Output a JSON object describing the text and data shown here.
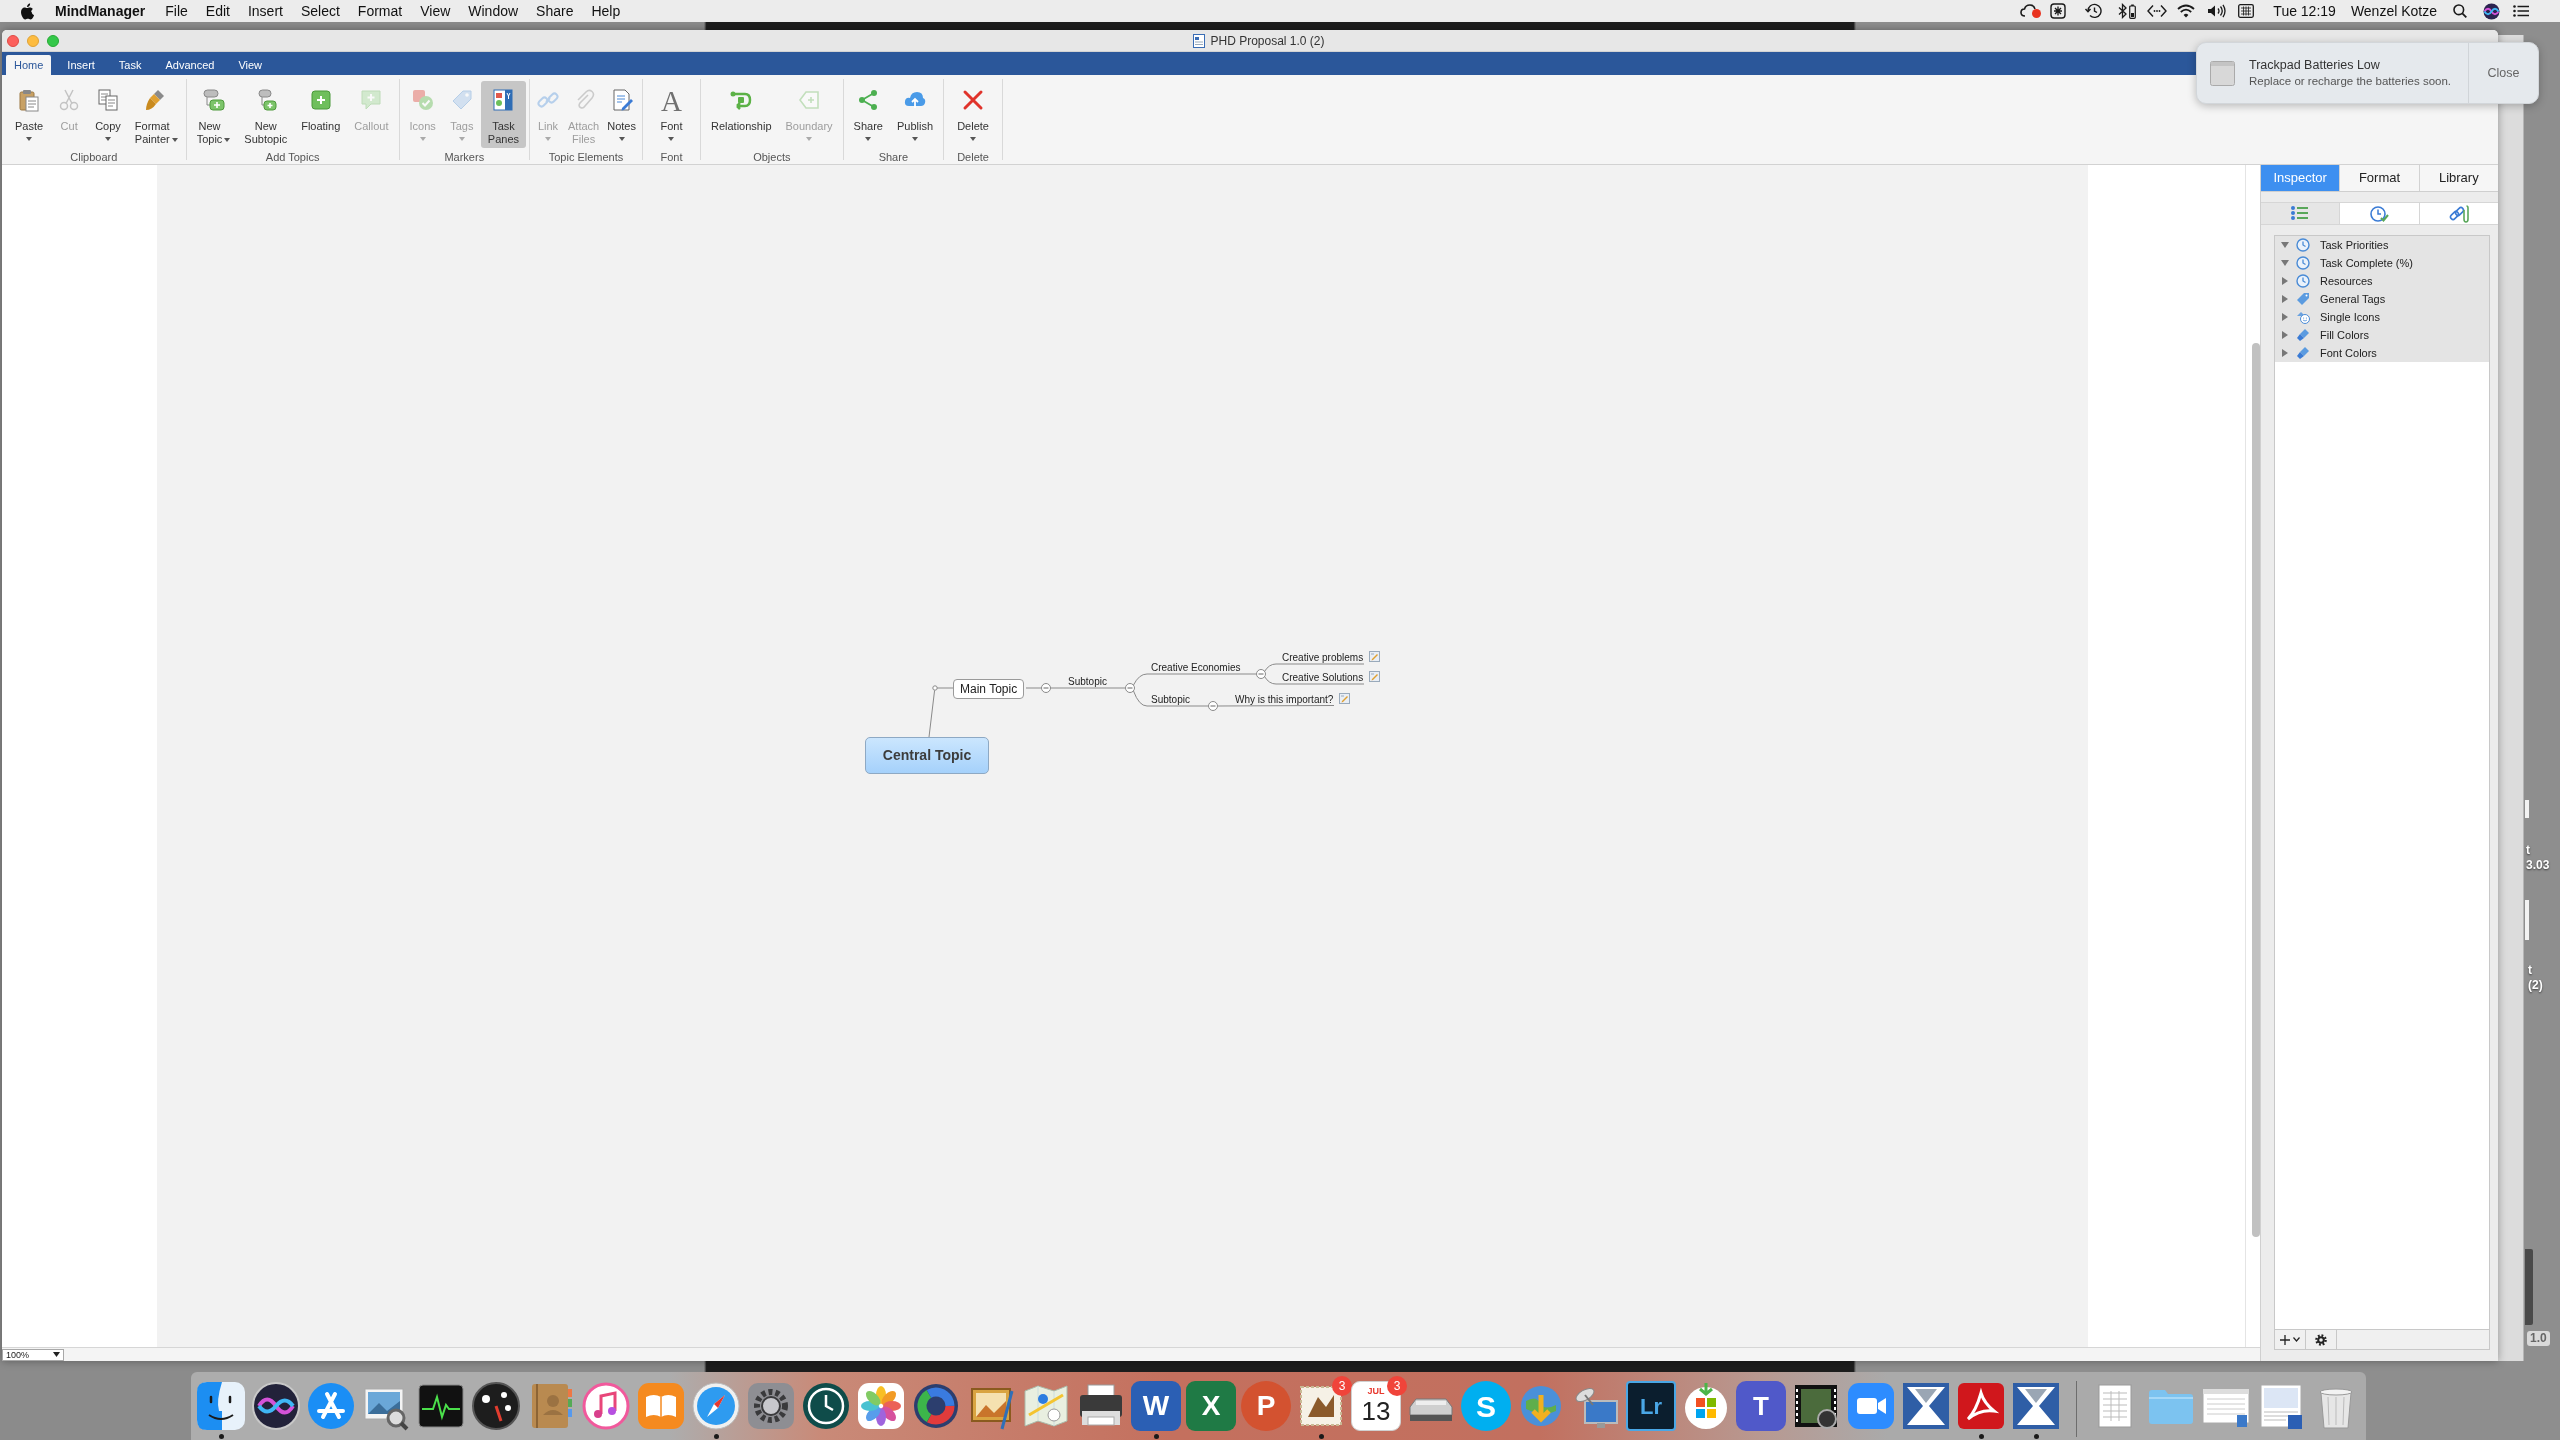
{
  "menu_bar": {
    "app_name": "MindManager",
    "menus": [
      "File",
      "Edit",
      "Insert",
      "Select",
      "Format",
      "View",
      "Window",
      "Share",
      "Help"
    ],
    "clock": "Tue 12:19",
    "user": "Wenzel Kotze"
  },
  "window": {
    "title": "PHD Proposal 1.0 (2)"
  },
  "ribbon": {
    "tabs": [
      {
        "label": "Home",
        "selected": true
      },
      {
        "label": "Insert",
        "selected": false
      },
      {
        "label": "Task",
        "selected": false
      },
      {
        "label": "Advanced",
        "selected": false
      },
      {
        "label": "View",
        "selected": false
      }
    ],
    "groups": [
      {
        "label": "Clipboard",
        "buttons": [
          {
            "label": "Paste",
            "dropdown": true,
            "disabled": false,
            "active": false
          },
          {
            "label": "Cut",
            "dropdown": false,
            "disabled": true,
            "active": false
          },
          {
            "label": "Copy",
            "dropdown": true,
            "disabled": false,
            "active": false
          },
          {
            "label": "Format Painter",
            "dropdown": true,
            "caret_inline": true,
            "disabled": false,
            "active": false
          }
        ]
      },
      {
        "label": "Add Topics",
        "buttons": [
          {
            "label": "New Topic",
            "dropdown": true,
            "caret_inline": true,
            "disabled": false,
            "active": false
          },
          {
            "label": "New Subtopic",
            "dropdown": false,
            "disabled": false,
            "active": false
          },
          {
            "label": "Floating",
            "dropdown": false,
            "disabled": false,
            "active": false
          },
          {
            "label": "Callout",
            "dropdown": false,
            "disabled": true,
            "active": false
          }
        ]
      },
      {
        "label": "Markers",
        "buttons": [
          {
            "label": "Icons",
            "dropdown": true,
            "disabled": true,
            "active": false
          },
          {
            "label": "Tags",
            "dropdown": true,
            "disabled": true,
            "active": false
          },
          {
            "label": "Task Panes",
            "dropdown": false,
            "disabled": false,
            "active": true
          }
        ]
      },
      {
        "label": "Topic Elements",
        "buttons": [
          {
            "label": "Link",
            "dropdown": true,
            "disabled": true,
            "active": false
          },
          {
            "label": "Attach Files",
            "dropdown": false,
            "disabled": true,
            "active": false
          },
          {
            "label": "Notes",
            "dropdown": true,
            "disabled": false,
            "active": false
          }
        ]
      },
      {
        "label": "Font",
        "buttons": [
          {
            "label": "Font",
            "glyph": "A",
            "dropdown": true,
            "disabled": false,
            "active": false
          }
        ]
      },
      {
        "label": "Objects",
        "buttons": [
          {
            "label": "Relationship",
            "dropdown": false,
            "disabled": false,
            "active": false
          },
          {
            "label": "Boundary",
            "dropdown": true,
            "disabled": true,
            "active": false
          }
        ]
      },
      {
        "label": "Share",
        "buttons": [
          {
            "label": "Share",
            "dropdown": true,
            "disabled": false,
            "active": false
          },
          {
            "label": "Publish",
            "dropdown": true,
            "disabled": false,
            "active": false
          }
        ]
      },
      {
        "label": "Delete",
        "buttons": [
          {
            "label": "Delete",
            "dropdown": true,
            "disabled": false,
            "active": false
          }
        ]
      }
    ]
  },
  "mind_map": {
    "central_topic": "Central Topic",
    "topics": [
      {
        "text": "Main Topic",
        "children": [
          {
            "text": "Subtopic",
            "children": [
              {
                "text": "Creative Economies",
                "children": [
                  {
                    "text": "Creative problems",
                    "note": true
                  },
                  {
                    "text": "Creative Solutions",
                    "note": true
                  }
                ]
              },
              {
                "text": "Subtopic",
                "children": [
                  {
                    "text": "Why is this important?",
                    "note": true
                  }
                ]
              }
            ]
          }
        ]
      }
    ]
  },
  "status_bar": {
    "zoom": "100%"
  },
  "task_pane": {
    "tabs": [
      {
        "label": "Inspector",
        "selected": true
      },
      {
        "label": "Format",
        "selected": false
      },
      {
        "label": "Library",
        "selected": false
      }
    ],
    "views": [
      {
        "selected": true
      },
      {
        "selected": false
      },
      {
        "selected": false
      }
    ],
    "items": [
      {
        "label": "Task Priorities",
        "expanded": true
      },
      {
        "label": "Task Complete (%)",
        "expanded": true
      },
      {
        "label": "Resources",
        "expanded": false
      },
      {
        "label": "General Tags",
        "expanded": false
      },
      {
        "label": "Single Icons",
        "expanded": false
      },
      {
        "label": "Fill Colors",
        "expanded": false
      },
      {
        "label": "Font Colors",
        "expanded": false
      }
    ]
  },
  "notification": {
    "title": "Trackpad Batteries Low",
    "message": "Replace or recharge the batteries soon.",
    "button": "Close"
  },
  "desktop": {
    "labels": [
      {
        "lines": [
          "t",
          "3.03"
        ]
      },
      {
        "lines": [
          "t",
          "(2)"
        ]
      },
      {
        "lines": [
          "1.0"
        ]
      }
    ]
  },
  "dock": {
    "apps": [
      {
        "running": true
      },
      {
        "running": false
      },
      {
        "running": false
      },
      {
        "running": false
      },
      {
        "running": false
      },
      {
        "running": false
      },
      {
        "running": false
      },
      {
        "running": false
      },
      {
        "running": false
      },
      {
        "running": true
      },
      {
        "running": false
      },
      {
        "running": false
      },
      {
        "running": false
      },
      {
        "running": false
      },
      {
        "running": false
      },
      {
        "running": false
      },
      {
        "running": false
      },
      {
        "running": true,
        "glyph": "W"
      },
      {
        "running": false,
        "glyph": "X"
      },
      {
        "running": false,
        "glyph": "P"
      },
      {
        "running": true,
        "badge": "3"
      },
      {
        "running": false,
        "month": "JUL",
        "day": "13",
        "badge": "3"
      },
      {
        "running": false
      },
      {
        "running": false,
        "glyph": "S"
      },
      {
        "running": false
      },
      {
        "running": false
      },
      {
        "running": false,
        "glyph": "Lr"
      },
      {
        "running": false
      },
      {
        "running": false,
        "glyph": "T"
      },
      {
        "running": false
      },
      {
        "running": false
      },
      {
        "running": false
      },
      {
        "running": true
      },
      {
        "running": true
      }
    ]
  }
}
